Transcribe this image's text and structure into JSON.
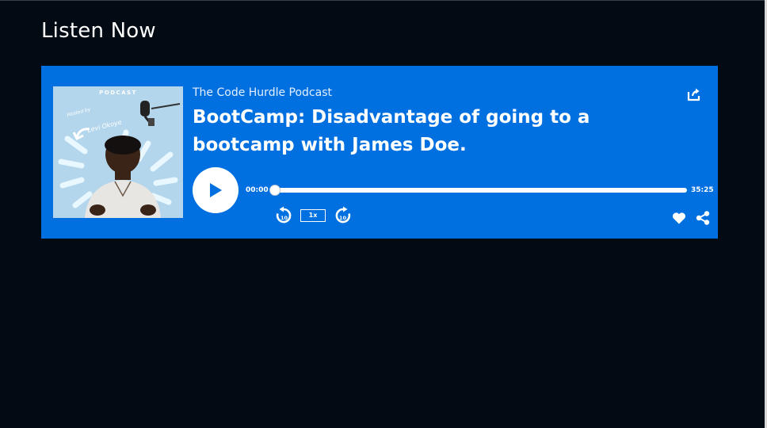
{
  "page": {
    "title": "Listen Now"
  },
  "player": {
    "show_name": "The Code Hurdle Podcast",
    "episode_title": "BootCamp: Disadvantage of going to a bootcamp with James Doe.",
    "current_time": "00:00",
    "duration": "35:25",
    "progress": 0,
    "speed": "1x",
    "skip_seconds": "10",
    "accent_color": "#0070e0",
    "icons": {
      "play": "play-icon",
      "export": "export-icon",
      "skip_back": "rewind-10-icon",
      "skip_forward": "forward-10-icon",
      "like": "heart-icon",
      "share": "share-icon"
    }
  },
  "cover": {
    "label": "PODCAST",
    "hosted_by": "Hosted by",
    "host_name": "Levi Okoye"
  }
}
